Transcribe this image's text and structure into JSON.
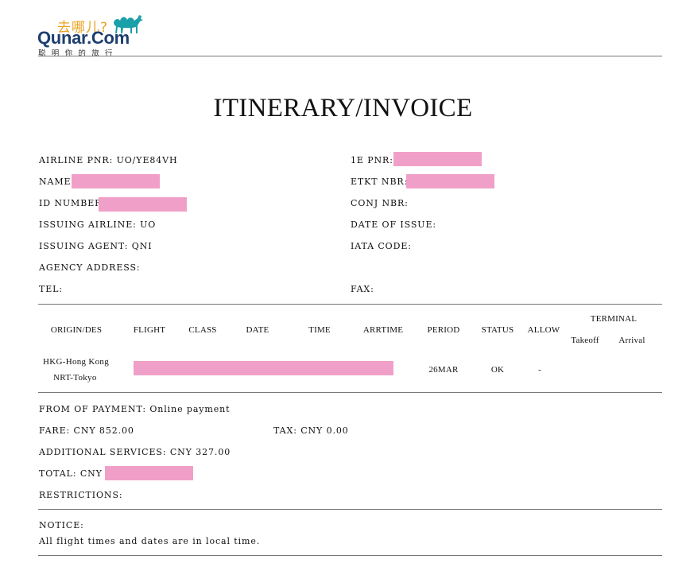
{
  "header": {
    "logo_cn": "去哪儿?",
    "logo_brand": "Qunar.Com",
    "logo_slogan": "聪明你的旅行"
  },
  "title": "ITINERARY/INVOICE",
  "info": {
    "airline_pnr": "AIRLINE PNR: UO/YE84VH",
    "name": "NAME:",
    "id_number": "ID NUMBER:",
    "issuing_airline": "ISSUING AIRLINE: UO",
    "issuing_agent": "ISSUING AGENT: QNI",
    "agency_address": "AGENCY ADDRESS:",
    "tel": "TEL:",
    "pnr_1e": "1E PNR: I",
    "etkt_nbr": "ETKT NBR:",
    "conj_nbr": "CONJ NBR:",
    "date_of_issue": "DATE OF ISSUE:",
    "iata_code": "IATA CODE:",
    "fax": "FAX:"
  },
  "table": {
    "headers": {
      "origin": "ORIGIN/DES",
      "flight": "FLIGHT",
      "class": "CLASS",
      "date": "DATE",
      "time": "TIME",
      "arrtime": "ARRTIME",
      "period": "PERIOD",
      "status": "STATUS",
      "allow": "ALLOW",
      "terminal": "TERMINAL",
      "takeoff": "Takeoff",
      "arrival": "Arrival"
    },
    "row": {
      "origin": "HKG-Hong Kong",
      "destination": "NRT-Tokyo",
      "period": "26MAR",
      "status": "OK",
      "allow": "-"
    }
  },
  "payment": {
    "form": "FROM OF PAYMENT: Online payment",
    "fare": "FARE: CNY 852.00",
    "tax": "TAX: CNY 0.00",
    "additional": "ADDITIONAL SERVICES: CNY 327.00",
    "total": "TOTAL: CNY",
    "restrictions": "RESTRICTIONS:"
  },
  "notice": {
    "label": "NOTICE:",
    "text": "All flight times and dates are in local time."
  },
  "colors": {
    "redaction": "#f0a0c8",
    "brand_blue": "#1d3f6e",
    "brand_orange": "#e8a21c",
    "camel_teal": "#1aa0a8"
  }
}
